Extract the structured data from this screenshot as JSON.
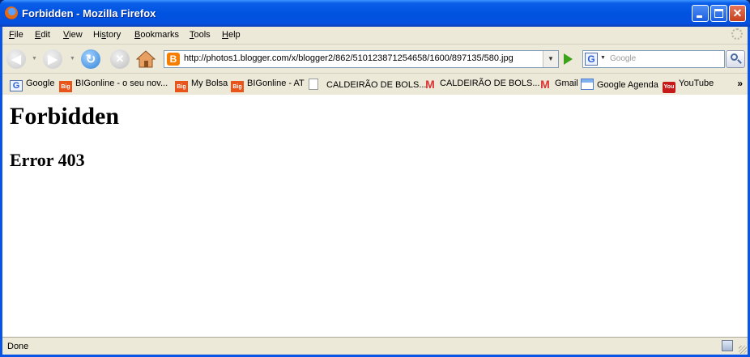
{
  "window": {
    "title": "Forbidden - Mozilla Firefox"
  },
  "menu": {
    "items": [
      {
        "label": "File",
        "key": "F",
        "rest": "ile"
      },
      {
        "label": "Edit",
        "key": "E",
        "rest": "dit"
      },
      {
        "label": "View",
        "key": "V",
        "rest": "iew"
      },
      {
        "label": "History",
        "key": "s",
        "pre": "Hi",
        "rest": "tory"
      },
      {
        "label": "Bookmarks",
        "key": "B",
        "rest": "ookmarks"
      },
      {
        "label": "Tools",
        "key": "T",
        "rest": "ools"
      },
      {
        "label": "Help",
        "key": "H",
        "rest": "elp"
      }
    ]
  },
  "navbar": {
    "url": "http://photos1.blogger.com/x/blogger2/862/510123871254658/1600/897135/580.jpg",
    "search_placeholder": "Google"
  },
  "bookmarks": [
    {
      "label": "Google",
      "icon": "google-icon"
    },
    {
      "label": "BIGonline - o seu nov...",
      "icon": "big-icon"
    },
    {
      "label": "My Bolsa",
      "icon": "big-icon"
    },
    {
      "label": "BIGonline - AT",
      "icon": "big-icon"
    },
    {
      "label": "CALDEIRÃO DE BOLS...",
      "icon": "page-icon"
    },
    {
      "label": "CALDEIRÃO DE BOLS...",
      "icon": "gmail-icon"
    },
    {
      "label": "Gmail",
      "icon": "gmail-icon"
    },
    {
      "label": "Google Agenda",
      "icon": "calendar-icon"
    },
    {
      "label": "YouTube",
      "icon": "youtube-icon"
    }
  ],
  "page": {
    "heading": "Forbidden",
    "subheading": "Error 403"
  },
  "status": {
    "text": "Done"
  }
}
